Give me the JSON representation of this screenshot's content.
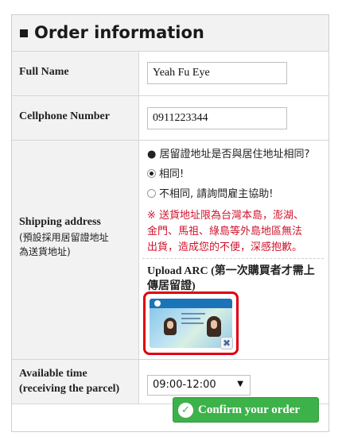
{
  "header": {
    "title": "Order information"
  },
  "full_name": {
    "label": "Full Name",
    "value": "Yeah Fu Eye"
  },
  "cellphone": {
    "label": "Cellphone Number",
    "value": "0911223344"
  },
  "shipping": {
    "label_line1": "Shipping address",
    "label_line2": "(預設採用居留證地址",
    "label_line3": "為送貨地址)",
    "question": "● 居留證地址是否與居住地址相同?",
    "option_yes": "相同!",
    "option_no": "不相同, 請詢問雇主協助!",
    "note_line1": "※ 送貨地址限為台灣本島，澎湖、",
    "note_line2": "金門、馬祖、綠島等外島地區無法",
    "note_line3": "出貨，造成您的不便，深感抱歉。",
    "upload_line1": "Upload ARC (第一次購買者才需上",
    "upload_line2": "傳居留證)"
  },
  "available_time": {
    "label_line1": "Available time",
    "label_line2": "(receiving the parcel)",
    "selected": "09:00-12:00"
  },
  "actions": {
    "confirm_label": "Confirm your order"
  },
  "colors": {
    "accent_green": "#3db24a",
    "highlight_red": "#e0000f",
    "note_red": "#d0132d"
  }
}
